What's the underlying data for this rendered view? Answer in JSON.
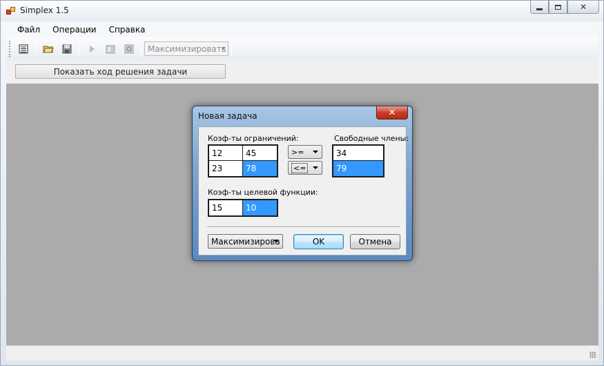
{
  "window": {
    "title": "Simplex 1.5"
  },
  "menu": {
    "items": [
      "Файл",
      "Операции",
      "Справка"
    ]
  },
  "toolbar": {
    "buttons": [
      "new-table-icon",
      "open-folder-icon",
      "save-disk-icon",
      "run-play-icon",
      "step-icon",
      "reset-icon"
    ],
    "combo_value": "Максимизировать"
  },
  "action": {
    "show_solution_label": "Показать ход решения задачи"
  },
  "dialog": {
    "title": "Новая задача",
    "close_glyph": "✕",
    "constraints_label": "Коэф-ты ограничений:",
    "constraints": [
      [
        "12",
        "45"
      ],
      [
        "23",
        "78"
      ]
    ],
    "signs": [
      ">=",
      "<="
    ],
    "free_terms_label": "Свободные члены:",
    "free_terms": [
      "34",
      "79"
    ],
    "objective_label": "Коэф-ты целевой функции:",
    "objective": [
      "15",
      "10"
    ],
    "mode_value": "Максимизирова",
    "ok_label": "OK",
    "cancel_label": "Отмена"
  },
  "colors": {
    "selection": "#3399ff",
    "client_bg": "#ababab",
    "dialog_frame": "#7fa6d0"
  }
}
